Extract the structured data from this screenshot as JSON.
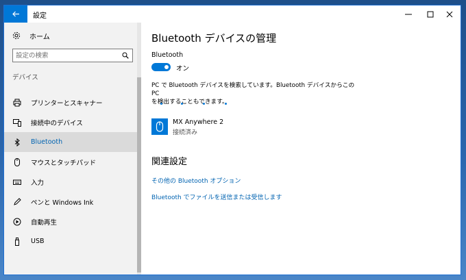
{
  "window": {
    "title": "設定"
  },
  "sidebar": {
    "home_label": "ホーム",
    "search_placeholder": "設定の検索",
    "section_label": "デバイス",
    "items": [
      {
        "label": "プリンターとスキャナー",
        "icon": "printer-icon"
      },
      {
        "label": "接続中のデバイス",
        "icon": "devices-icon"
      },
      {
        "label": "Bluetooth",
        "icon": "bluetooth-icon",
        "selected": true
      },
      {
        "label": "マウスとタッチパッド",
        "icon": "mouse-icon"
      },
      {
        "label": "入力",
        "icon": "keyboard-icon"
      },
      {
        "label": "ペンと Windows Ink",
        "icon": "pen-icon"
      },
      {
        "label": "自動再生",
        "icon": "autoplay-icon"
      },
      {
        "label": "USB",
        "icon": "usb-icon"
      }
    ]
  },
  "main": {
    "title": "Bluetooth デバイスの管理",
    "bluetooth_label": "Bluetooth",
    "toggle_state": "オン",
    "description_line1": "PC で Bluetooth デバイスを検索しています。Bluetooth デバイスからこの PC",
    "description_line2": "を検出することもできます。",
    "device": {
      "name": "MX Anywhere 2",
      "status": "接続済み"
    },
    "related_title": "関連設定",
    "links": [
      "その他の Bluetooth オプション",
      "Bluetooth でファイルを送信または受信します"
    ]
  },
  "colors": {
    "accent": "#0078d7",
    "link": "#0063b1",
    "sidebar_bg": "#f2f2f2",
    "selected_bg": "#dadada"
  }
}
